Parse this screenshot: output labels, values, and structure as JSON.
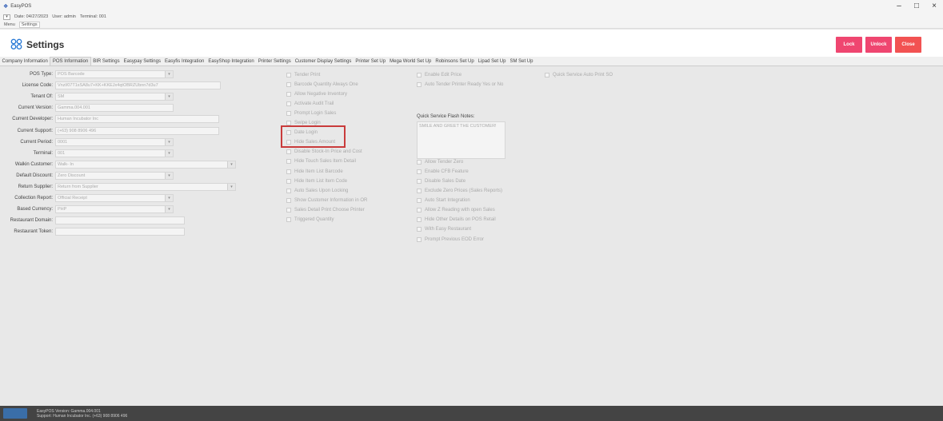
{
  "app": {
    "name": "EasyPOS"
  },
  "infobar": {
    "date": "Date: 04/27/2023",
    "user": "User: admin",
    "terminal": "Terminal: 001"
  },
  "menu": {
    "tabs": [
      "Menu",
      "Settings"
    ]
  },
  "page": {
    "title": "Settings"
  },
  "buttons": {
    "lock": "Lock",
    "unlock": "Unlock",
    "close": "Close"
  },
  "colors": {
    "lock": "#ef4670",
    "unlock": "#ef4670",
    "close": "#f25252",
    "highlight": "#c93b3b",
    "footer": "#444444"
  },
  "tabs": [
    "Company Information",
    "POS Information",
    "BIR Settings",
    "Easypay Settings",
    "Easyfis Integration",
    "EasyShop Integration",
    "Printer Settings",
    "Customer Display Settings",
    "Printer Set Up",
    "Mega World Set Up",
    "Robinsons Set Up",
    "Lipad Set Up",
    "SM Set Up"
  ],
  "active_tab": "POS Information",
  "fields": [
    {
      "label": "POS Type:",
      "value": "POS Barcode",
      "dropdown": true
    },
    {
      "label": "License Code:",
      "value": "Vnzl/07T1sSA8u7+KK+KKEJx4qtOBRZUbnn7d3u7",
      "dropdown": false
    },
    {
      "label": "Tenant Of:",
      "value": "SM",
      "dropdown": true
    },
    {
      "label": "Current Version:",
      "value": "Gamma.004.001",
      "dropdown": false
    },
    {
      "label": "Current Developer:",
      "value": "Human Incubator Inc",
      "dropdown": false
    },
    {
      "label": "Current Support:",
      "value": "(+63) 908 8906 496",
      "dropdown": false
    },
    {
      "label": "Current Period:",
      "value": "0001",
      "dropdown": true
    },
    {
      "label": "Terminal:",
      "value": "001",
      "dropdown": true
    },
    {
      "label": "Walkin Customer:",
      "value": "Walk- In",
      "dropdown": true
    },
    {
      "label": "Default Discount:",
      "value": "Zero Discount",
      "dropdown": true
    },
    {
      "label": "Return Supplier:",
      "value": "Return from Supplier",
      "dropdown": true
    },
    {
      "label": "Collection Report:",
      "value": "Official Receipt",
      "dropdown": true
    },
    {
      "label": "Based Currency:",
      "value": "PHP",
      "dropdown": true
    },
    {
      "label": "Restaurant Domain:",
      "value": "",
      "dropdown": false
    },
    {
      "label": "Restaurant Token:",
      "value": "",
      "dropdown": false
    }
  ],
  "checks_col1": [
    "Tender Print",
    "Barcode Quantity Always One",
    "Allow Negative Inventory",
    "Activate Audit Trail",
    "Prompt Login Sales",
    "Swipe Login",
    "Date Login",
    "Hide Sales Amount",
    "Disable Stock-In Price and Cost",
    "Hide Touch Sales Item Detail",
    "Hide Item List Barcode",
    "Hide Item List Item Code",
    "Auto Sales Upon Locking",
    "Show Customer Information in OR",
    "Sales Detail Print Choose Printer",
    "Triggered Quantity"
  ],
  "checks_col2_top": [
    "Enable Edit Price",
    "Auto Tender Printer Ready Yes or No"
  ],
  "notes": {
    "label": "Quick Service Flash Notes:",
    "value": "SMILE AND GREET THE CUSTOMER!"
  },
  "checks_col2": [
    "Show Add Service Charge",
    "Enable Parking System Feature",
    "Allow Tender Zero",
    "Enable CFB Feature",
    "Disable Sales Date",
    "Exclude Zero Prices (Sales Reports)",
    "Auto Start Integration",
    "Allow Z Reading with open Sales",
    "Hide Other Details on POS Retail",
    "With Easy Restaurant",
    "Prompt Previous EOD Error"
  ],
  "checks_col3": [
    "Quick Service Auto Print SO"
  ],
  "footer": {
    "version": "EasyPOS Version: Gamma.004.001",
    "support": "Support: Human Incubator Inc. (+63) 908 8906 496"
  }
}
